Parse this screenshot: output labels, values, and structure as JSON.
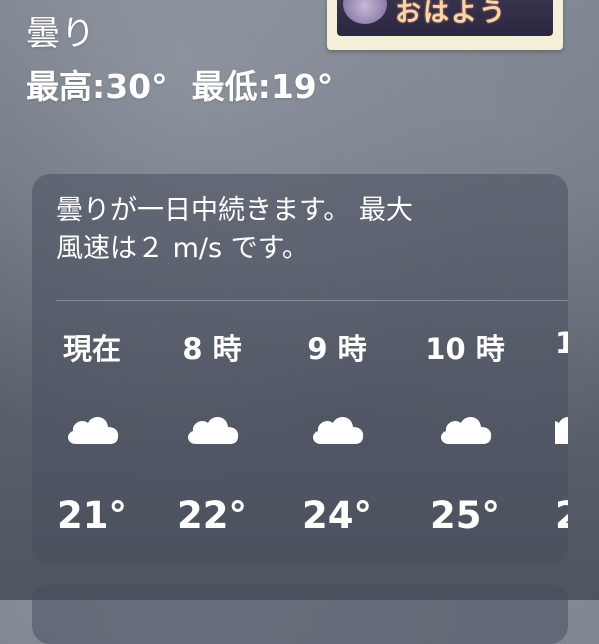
{
  "header": {
    "condition": "曇り",
    "high": "最高:30°",
    "low": "最低:19°"
  },
  "sticker": {
    "text": "おはよう"
  },
  "forecast": {
    "summary_line1": "曇りが一日中続きます。 最大",
    "summary_line2": "風速は２ m/s です。",
    "hours": [
      {
        "label": "現在",
        "icon": "cloud-icon",
        "temp": "21°"
      },
      {
        "label": "8 時",
        "icon": "cloud-icon",
        "temp": "22°"
      },
      {
        "label": "9 時",
        "icon": "cloud-icon",
        "temp": "24°"
      },
      {
        "label": "10 時",
        "icon": "cloud-icon",
        "temp": "25°"
      },
      {
        "label": "1",
        "icon": "cloud-icon",
        "temp": "2"
      }
    ]
  }
}
